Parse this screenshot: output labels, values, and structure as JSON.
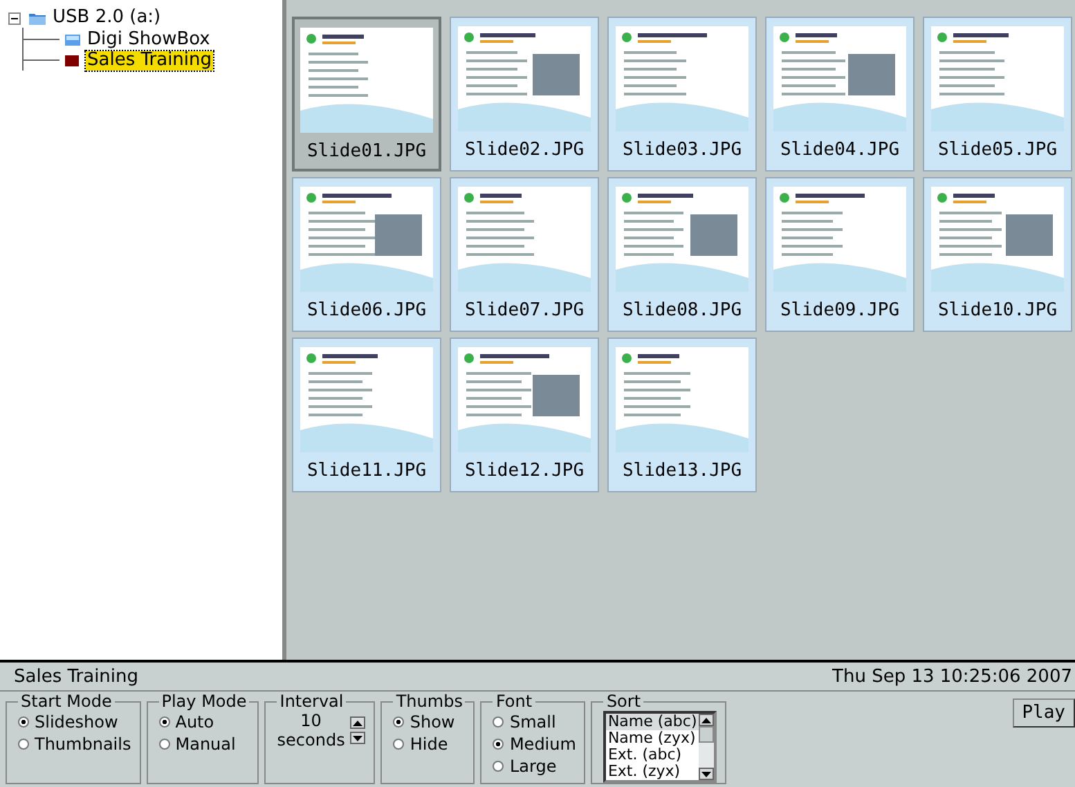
{
  "tree": {
    "label": "USB 2.0 (a:)",
    "expanded": true,
    "children": [
      {
        "label": "Digi ShowBox",
        "selected": false,
        "kind": "folder"
      },
      {
        "label": "Sales Training",
        "selected": true,
        "kind": "show"
      }
    ]
  },
  "thumbnails": [
    {
      "label": "Slide01.JPG",
      "selected": true
    },
    {
      "label": "Slide02.JPG",
      "selected": false
    },
    {
      "label": "Slide03.JPG",
      "selected": false
    },
    {
      "label": "Slide04.JPG",
      "selected": false
    },
    {
      "label": "Slide05.JPG",
      "selected": false
    },
    {
      "label": "Slide06.JPG",
      "selected": false
    },
    {
      "label": "Slide07.JPG",
      "selected": false
    },
    {
      "label": "Slide08.JPG",
      "selected": false
    },
    {
      "label": "Slide09.JPG",
      "selected": false
    },
    {
      "label": "Slide10.JPG",
      "selected": false
    },
    {
      "label": "Slide11.JPG",
      "selected": false
    },
    {
      "label": "Slide12.JPG",
      "selected": false
    },
    {
      "label": "Slide13.JPG",
      "selected": false
    }
  ],
  "status_bar": {
    "title": "Sales Training",
    "datetime": "Thu Sep 13 10:25:06 2007"
  },
  "groups": [
    {
      "kind": "radio",
      "title": "Start Mode",
      "options": [
        {
          "label": "Slideshow",
          "selected": true
        },
        {
          "label": "Thumbnails",
          "selected": false
        }
      ]
    },
    {
      "kind": "radio",
      "title": "Play Mode",
      "options": [
        {
          "label": "Auto",
          "selected": true
        },
        {
          "label": "Manual",
          "selected": false
        }
      ]
    },
    {
      "kind": "spinner",
      "title": "Interval",
      "value": "10",
      "unit": "seconds"
    },
    {
      "kind": "radio",
      "title": "Thumbs",
      "options": [
        {
          "label": "Show",
          "selected": true
        },
        {
          "label": "Hide",
          "selected": false
        }
      ]
    },
    {
      "kind": "radio",
      "title": "Font",
      "options": [
        {
          "label": "Small",
          "selected": false
        },
        {
          "label": "Medium",
          "selected": true
        },
        {
          "label": "Large",
          "selected": false
        }
      ]
    },
    {
      "kind": "list",
      "title": "Sort",
      "options": [
        {
          "label": "Name (abc)",
          "selected": true
        },
        {
          "label": "Name (zyx)",
          "selected": false
        },
        {
          "label": "Ext. (abc)",
          "selected": false
        },
        {
          "label": "Ext. (zyx)",
          "selected": false
        }
      ]
    }
  ],
  "play_button": "Play"
}
